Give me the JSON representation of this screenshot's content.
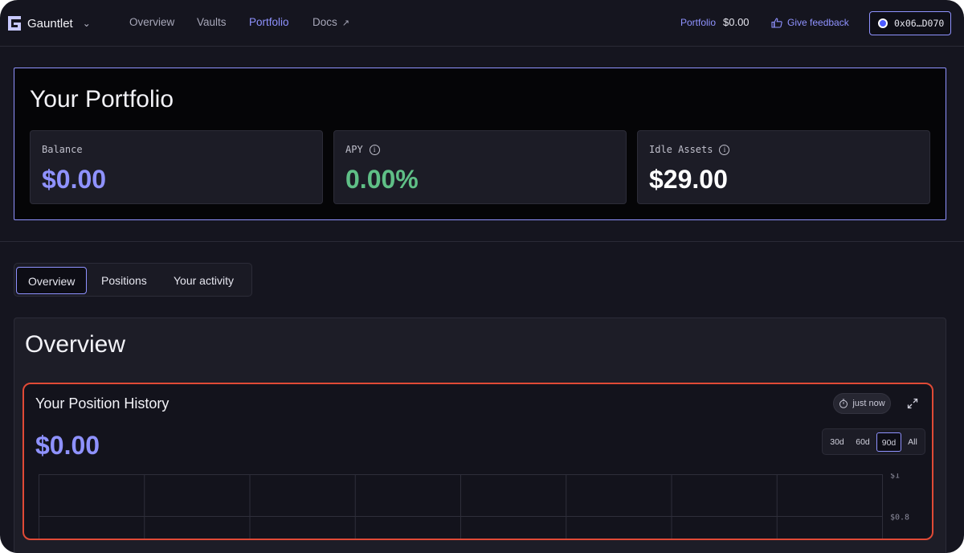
{
  "nav": {
    "brand": "Gauntlet",
    "links": [
      "Overview",
      "Vaults",
      "Portfolio",
      "Docs"
    ],
    "active_link": "Portfolio",
    "portfolio_label": "Portfolio",
    "portfolio_value": "$0.00",
    "feedback_label": "Give feedback",
    "wallet_address": "0x06…D070"
  },
  "portfolio": {
    "title": "Your Portfolio",
    "stats": [
      {
        "label": "Balance",
        "value": "$0.00",
        "color": "#8f92ff",
        "info": false
      },
      {
        "label": "APY",
        "value": "0.00%",
        "color": "#5fbf86",
        "info": true
      },
      {
        "label": "Idle Assets",
        "value": "$29.00",
        "color": "#ffffff",
        "info": true
      }
    ]
  },
  "tabs": {
    "items": [
      "Overview",
      "Positions",
      "Your activity"
    ],
    "active": "Overview"
  },
  "overview": {
    "title": "Overview",
    "history": {
      "title": "Your Position History",
      "value": "$0.00",
      "refreshed": "just now",
      "ranges": [
        "30d",
        "60d",
        "90d",
        "All"
      ],
      "active_range": "90d"
    }
  },
  "chart_data": {
    "type": "line",
    "y_tick_labels": [
      "$1",
      "$0.8"
    ],
    "y_ticks": [
      1,
      0.8
    ],
    "series": [],
    "grid": true
  },
  "colors": {
    "accent": "#8f92ff",
    "positive": "#5fbf86",
    "highlight": "#e04a36"
  }
}
